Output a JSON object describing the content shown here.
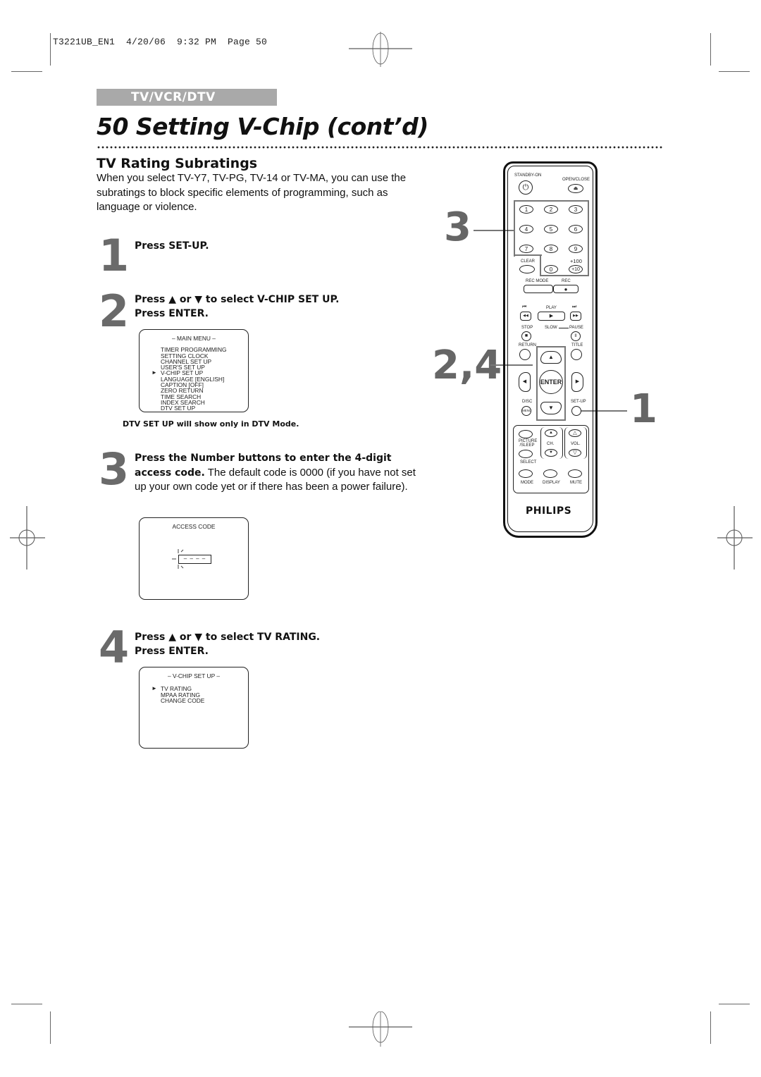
{
  "slug": "T3221UB_EN1  4/20/06  9:32 PM  Page 50",
  "section_tab": "TV/VCR/DTV",
  "page_title": "50  Setting V-Chip (cont’d)",
  "subsection": {
    "title": "TV Rating Subratings",
    "intro": "When you select TV-Y7, TV-PG, TV-14 or TV-MA, you can use the subratings to block specific elements of programming, such as language or violence."
  },
  "steps": [
    {
      "num": "1",
      "bold": "Press SET-UP.",
      "rest": ""
    },
    {
      "num": "2",
      "bold_line1": "Press ▲ or ▼ to select V-CHIP SET UP.",
      "bold_line2": "Press ENTER."
    },
    {
      "num": "3",
      "bold": "Press the Number buttons to enter the 4-digit access code.",
      "rest": " The default code is 0000 (if you have not set up your own code yet or if there has been a power failure)."
    },
    {
      "num": "4",
      "bold_line1": "Press ▲ or ▼ to select TV RATING.",
      "bold_line2": "Press ENTER."
    }
  ],
  "main_menu_screen": {
    "header": "– MAIN MENU –",
    "items": [
      "TIMER PROGRAMMING",
      "SETTING CLOCK",
      "CHANNEL SET UP",
      "USER'S SET UP",
      "V-CHIP SET UP",
      "LANGUAGE  [ENGLISH]",
      "CAPTION  [OFF]",
      "ZERO RETURN",
      "TIME SEARCH",
      "INDEX SEARCH",
      "DTV SET UP"
    ],
    "selected_index": 4,
    "arrow": "►"
  },
  "note": {
    "bold": "DTV SET UP",
    "rest": " will show only in DTV Mode."
  },
  "access_code_screen": {
    "header": "ACCESS CODE",
    "placeholder": "– – – –"
  },
  "vchip_screen": {
    "header": "– V-CHIP SET UP –",
    "items": [
      "TV RATING",
      "MPAA RATING",
      "CHANGE CODE"
    ],
    "selected_index": 0,
    "arrow": "►"
  },
  "callouts": {
    "c3": "3",
    "c24": "2,4",
    "c1": "1"
  },
  "remote": {
    "standby": "STANDBY-ON",
    "open_close": "OPEN/CLOSE",
    "power_icon": "⏻",
    "eject_icon": "⏏",
    "digits": [
      "1",
      "2",
      "3",
      "4",
      "5",
      "6",
      "7",
      "8",
      "9"
    ],
    "clear": "CLEAR",
    "zero": "0",
    "plus100": "+100",
    "plus10": "+10",
    "rec_mode": "REC MODE",
    "rec": "REC",
    "rec_icon": "●",
    "skip_back_icon": "⏮",
    "play": "PLAY",
    "skip_fwd_icon": "⏭",
    "rew_icon": "◀◀",
    "play_icon": "▶",
    "ff_icon": "▶▶",
    "stop": "STOP",
    "slow": "SLOW",
    "pause": "PAUSE",
    "stop_icon": "■",
    "pause_icon": "II",
    "return": "RETURN",
    "title": "TITLE",
    "up_icon": "▲",
    "down_icon": "▼",
    "left_icon": "◀",
    "right_icon": "▶",
    "enter": "ENTER",
    "disc": "DISC",
    "menu": "MENU",
    "setup": "SET-UP",
    "picture_sleep": "PICTURE /SLEEP",
    "ch": "CH.",
    "vol": "VOL.",
    "vol_up_icon": "△",
    "vol_down_icon": "▽",
    "select": "SELECT",
    "mode": "MODE",
    "display": "DISPLAY",
    "mute": "MUTE",
    "brand": "PHILIPS"
  }
}
